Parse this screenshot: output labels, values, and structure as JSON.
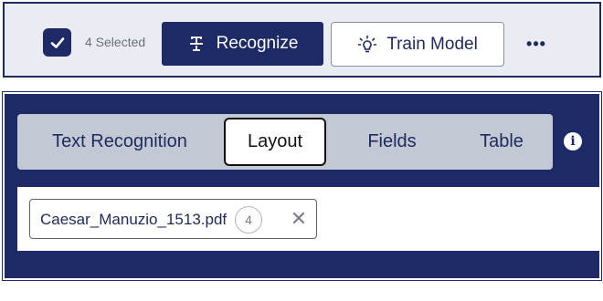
{
  "toolbar": {
    "checkbox_icon": "checkmark-icon",
    "selected_label": "4 Selected",
    "recognize_label": "Recognize",
    "recognize_icon": "text-recognize-icon",
    "train_label": "Train Model",
    "train_icon": "lightbulb-icon",
    "more_label": "•••"
  },
  "tabs": {
    "items": [
      {
        "label": "Text Recognition"
      },
      {
        "label": "Layout"
      },
      {
        "label": "Fields"
      },
      {
        "label": "Table"
      }
    ],
    "active": "Layout",
    "info_label": "i"
  },
  "file": {
    "name": "Caesar_Manuzio_1513.pdf",
    "count": "4",
    "remove_label": "✕"
  },
  "colors": {
    "primary": "#1e2a66",
    "toolbar_bg": "#e9ecf3",
    "tabs_bg": "#c3c8d5"
  }
}
